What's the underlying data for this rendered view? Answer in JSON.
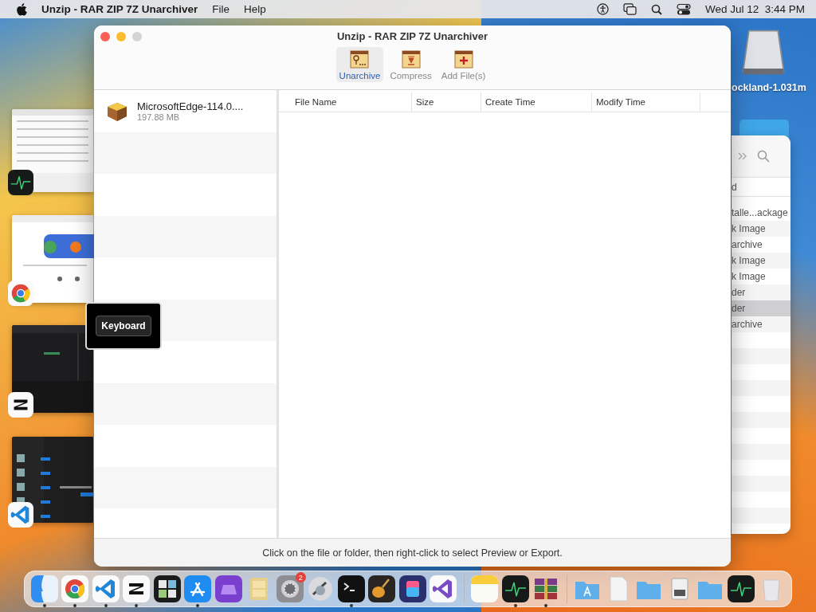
{
  "menu_bar": {
    "app_name": "Unzip - RAR ZIP 7Z Unarchiver",
    "menus": [
      "File",
      "Help"
    ],
    "clock": "Wed Jul 12  3:44 PM"
  },
  "stage_manager": [
    {
      "kind": "activity"
    },
    {
      "kind": "chrome"
    },
    {
      "kind": "capcut"
    },
    {
      "kind": "vscode"
    }
  ],
  "desktop_icons": [
    {
      "kind": "drive",
      "label": "ockland-1.031m"
    },
    {
      "kind": "folder"
    }
  ],
  "window": {
    "title": "Unzip - RAR ZIP 7Z Unarchiver",
    "toolbar": [
      {
        "kind": "unarchive",
        "label": "Unarchive",
        "selected": true
      },
      {
        "kind": "compress",
        "label": "Compress",
        "selected": false
      },
      {
        "kind": "add",
        "label": "Add File(s)",
        "selected": false
      }
    ],
    "archives": [
      {
        "name": "MicrosoftEdge-114.0....",
        "size": "197.88 MB"
      }
    ],
    "columns": [
      "File Name",
      "Size",
      "Create Time",
      "Modify Time"
    ],
    "status": "Click on the file or folder, then right-click to select Preview or Export."
  },
  "tooltip": "Keyboard",
  "finder": {
    "column_header": "d",
    "rows": [
      {
        "text": "talle...ackage",
        "selected": false
      },
      {
        "text": "k Image",
        "selected": false
      },
      {
        "text": "archive",
        "selected": false
      },
      {
        "text": "k Image",
        "selected": false
      },
      {
        "text": "k Image",
        "selected": false
      },
      {
        "text": "der",
        "selected": false
      },
      {
        "text": "der",
        "selected": true
      },
      {
        "text": "archive",
        "selected": false
      }
    ]
  },
  "dock": [
    {
      "kind": "finder",
      "running": true
    },
    {
      "kind": "chrome",
      "running": true
    },
    {
      "kind": "vscode",
      "running": true
    },
    {
      "kind": "capcut",
      "running": true
    },
    {
      "kind": "tiles",
      "running": false
    },
    {
      "kind": "appstore",
      "running": true
    },
    {
      "kind": "purple",
      "running": false
    },
    {
      "kind": "cabinet",
      "running": false
    },
    {
      "kind": "settings",
      "running": false,
      "badge": "2"
    },
    {
      "kind": "robot",
      "running": false
    },
    {
      "kind": "terminal",
      "running": true
    },
    {
      "kind": "guitar",
      "running": false
    },
    {
      "kind": "shortcuts",
      "running": false
    },
    {
      "kind": "vs",
      "running": false
    },
    {
      "kind": "separator"
    },
    {
      "kind": "notes",
      "running": false
    },
    {
      "kind": "activity",
      "running": true
    },
    {
      "kind": "books",
      "running": true
    },
    {
      "kind": "separator"
    },
    {
      "kind": "appfolder",
      "running": false
    },
    {
      "kind": "document",
      "running": false
    },
    {
      "kind": "folder",
      "running": false
    },
    {
      "kind": "disk",
      "running": false
    },
    {
      "kind": "folder",
      "running": false
    },
    {
      "kind": "activity",
      "running": false
    },
    {
      "kind": "trash",
      "running": false
    }
  ]
}
